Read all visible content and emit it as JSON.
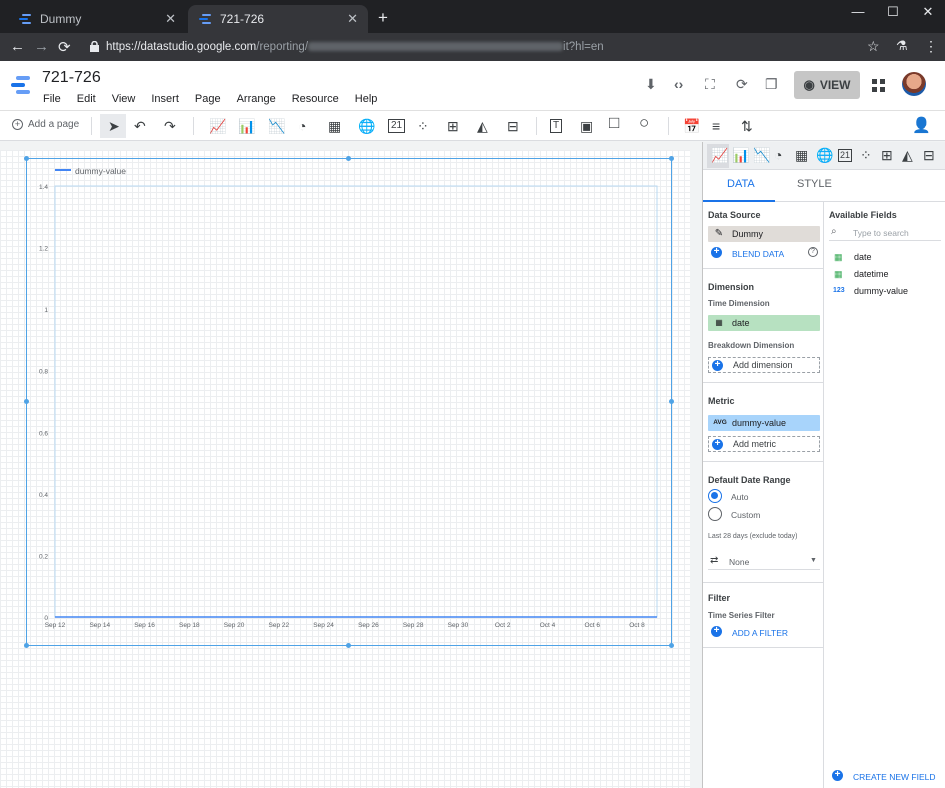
{
  "browser": {
    "tabs": [
      {
        "title": "Dummy"
      },
      {
        "title": "721-726"
      }
    ],
    "url": {
      "prefix": "https://datastudio.google.com",
      "path": "/reporting/",
      "suffix": "it?hl=en"
    }
  },
  "app": {
    "report_title": "721-726",
    "menu": [
      "File",
      "Edit",
      "View",
      "Insert",
      "Page",
      "Arrange",
      "Resource",
      "Help"
    ],
    "view_label": "VIEW"
  },
  "toolbar": {
    "add_page_label": "Add a page"
  },
  "chart_data": {
    "type": "line",
    "legend": "dummy-value",
    "legend_position": "top-left",
    "grid": true,
    "ylim": [
      0,
      1.4
    ],
    "yticks": [
      "0",
      "0.2",
      "0.4",
      "0.6",
      "0.8",
      "1",
      "1.2",
      "1.4"
    ],
    "xticks": [
      "Sep 12",
      "Sep 14",
      "Sep 16",
      "Sep 18",
      "Sep 20",
      "Sep 22",
      "Sep 24",
      "Sep 26",
      "Sep 28",
      "Sep 30",
      "Oct 2",
      "Oct 4",
      "Oct 6",
      "Oct 8"
    ],
    "series": [
      {
        "name": "dummy-value",
        "color": "#4285f4",
        "values": [
          0,
          0,
          0,
          0,
          0,
          0,
          0,
          0,
          0,
          0,
          0,
          0,
          0,
          0
        ]
      }
    ]
  },
  "panel": {
    "tabs": [
      "DATA",
      "STYLE"
    ],
    "data_source": {
      "heading": "Data Source",
      "name": "Dummy",
      "blend_label": "BLEND DATA"
    },
    "dimension": {
      "heading": "Dimension",
      "time_heading": "Time Dimension",
      "time_value": "date",
      "breakdown_heading": "Breakdown Dimension",
      "add_label": "Add dimension"
    },
    "metric": {
      "heading": "Metric",
      "agg": "AVG",
      "value": "dummy-value",
      "add_label": "Add metric"
    },
    "date_range": {
      "heading": "Default Date Range",
      "options": [
        "Auto",
        "Custom"
      ],
      "selected": "Auto",
      "note": "Last 28 days (exclude today)",
      "compare_value": "None"
    },
    "filter": {
      "heading": "Filter",
      "sub": "Time Series Filter",
      "add_label": "ADD A FILTER"
    },
    "available": {
      "heading": "Available Fields",
      "search_placeholder": "Type to search",
      "fields": [
        {
          "name": "date",
          "type": "date"
        },
        {
          "name": "datetime",
          "type": "date"
        },
        {
          "name": "dummy-value",
          "type": "number"
        }
      ],
      "create_label": "CREATE NEW FIELD"
    }
  },
  "colors": {
    "accent": "#1a73e8",
    "dimension_chip": "#b7e1c1",
    "metric_chip": "#a8d4fb",
    "datasource_chip": "#e0dcd8"
  }
}
